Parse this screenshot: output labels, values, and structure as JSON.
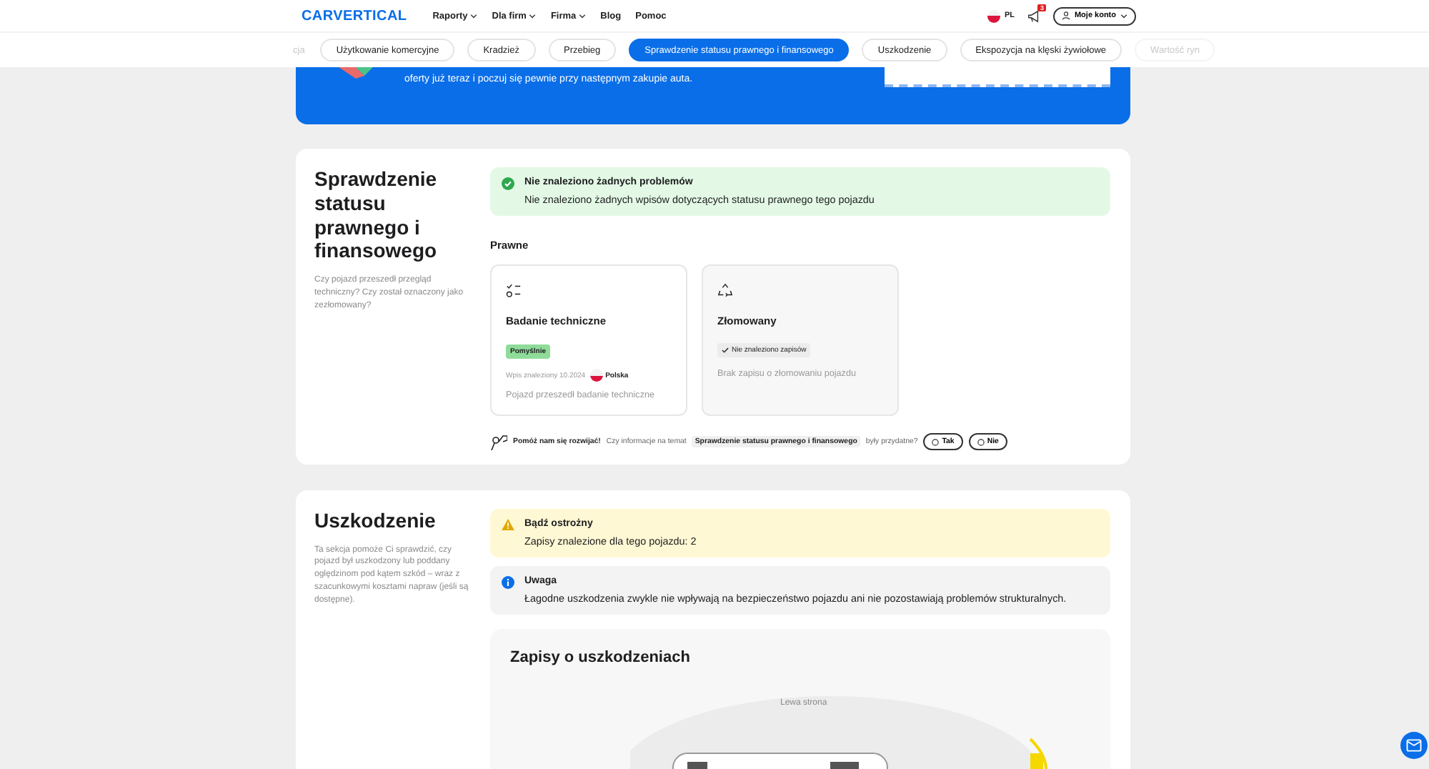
{
  "header": {
    "logo": "CARVERTICAL",
    "nav": [
      {
        "label": "Raporty",
        "dropdown": true
      },
      {
        "label": "Dla firm",
        "dropdown": true
      },
      {
        "label": "Firma",
        "dropdown": true
      },
      {
        "label": "Blog",
        "dropdown": false
      },
      {
        "label": "Pomoc",
        "dropdown": false
      }
    ],
    "language": "PL",
    "notifications": "3",
    "account": "Moje konto"
  },
  "tabs": [
    {
      "label": "cja",
      "selected": false,
      "faded": true
    },
    {
      "label": "Użytkowanie komercyjne",
      "selected": false,
      "faded": false
    },
    {
      "label": "Kradzież",
      "selected": false,
      "faded": false
    },
    {
      "label": "Przebieg",
      "selected": false,
      "faded": false
    },
    {
      "label": "Sprawdzenie statusu prawnego i finansowego",
      "selected": true,
      "faded": false
    },
    {
      "label": "Uszkodzenie",
      "selected": false,
      "faded": false
    },
    {
      "label": "Ekspozycja na klęski żywiołowe",
      "selected": false,
      "faded": false
    },
    {
      "label": "Wartość ryn",
      "selected": false,
      "faded": true
    }
  ],
  "banner": {
    "text": "oferty już teraz i poczuj się pewnie przy następnym zakupie auta."
  },
  "legal_section": {
    "title": "Sprawdzenie statusu prawnego i finansowego",
    "description": "Czy pojazd przeszedł przegląd techniczny? Czy został oznaczony jako zezłomowany?",
    "alert": {
      "kind": "success",
      "title": "Nie znaleziono żadnych problemów",
      "text": "Nie znaleziono żadnych wpisów dotyczących statusu prawnego tego pojazdu"
    },
    "group_label": "Prawne",
    "cards": [
      {
        "kind": "record",
        "title": "Badanie techniczne",
        "badge": "Pomyślnie",
        "meta": "Wpis znaleziony 10.2024",
        "country": "Polska",
        "note": "Pojazd przeszedł badanie techniczne"
      },
      {
        "kind": "empty",
        "title": "Złomowany",
        "status": "Nie znaleziono zapisów",
        "note": "Brak zapisu o złomowaniu pojazdu"
      }
    ],
    "feedback": {
      "prompt": "Pomóż nam się rozwijać!",
      "before": "Czy informacje na temat",
      "topic": "Sprawdzenie statusu prawnego i finansowego",
      "after": "były przydatne?",
      "buttons": [
        "Tak",
        "Nie"
      ]
    }
  },
  "damage_section": {
    "title": "Uszkodzenie",
    "description": "Ta sekcja pomoże Ci sprawdzić, czy pojazd był uszkodzony lub poddany oględzinom pod kątem szkód – wraz z szacunkowymi kosztami napraw (jeśli są dostępne).",
    "alerts": [
      {
        "kind": "warning",
        "title": "Bądź ostrożny",
        "text": "Zapisy znalezione dla tego pojazdu: 2"
      },
      {
        "kind": "info",
        "title": "Uwaga",
        "text": "Łagodne uszkodzenia zwykle nie wpływają na bezpieczeństwo pojazdu ani nie pozostawiają problemów strukturalnych."
      }
    ],
    "records_title": "Zapisy o uszkodzeniach",
    "diagram_label": "Lewa strona"
  }
}
